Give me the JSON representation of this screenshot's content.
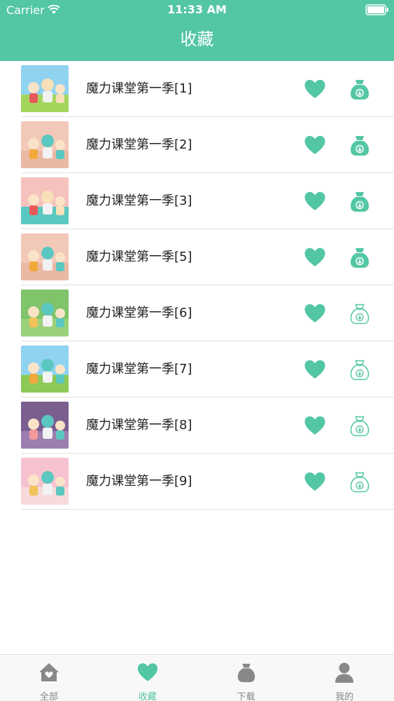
{
  "status_bar": {
    "carrier": "Carrier",
    "time": "11:33 AM",
    "wifi_icon": "wifi-icon",
    "battery_icon": "battery-icon"
  },
  "header": {
    "title": "收藏",
    "background": "#53c6a4"
  },
  "favorites": [
    {
      "title": "魔力课堂第一季[1]",
      "favorited": true,
      "downloaded": true
    },
    {
      "title": "魔力课堂第一季[2]",
      "favorited": true,
      "downloaded": true
    },
    {
      "title": "魔力课堂第一季[3]",
      "favorited": true,
      "downloaded": true
    },
    {
      "title": "魔力课堂第一季[5]",
      "favorited": true,
      "downloaded": true
    },
    {
      "title": "魔力课堂第一季[6]",
      "favorited": true,
      "downloaded": false
    },
    {
      "title": "魔力课堂第一季[7]",
      "favorited": true,
      "downloaded": false
    },
    {
      "title": "魔力课堂第一季[8]",
      "favorited": true,
      "downloaded": false
    },
    {
      "title": "魔力课堂第一季[9]",
      "favorited": true,
      "downloaded": false
    }
  ],
  "tabbar": {
    "tabs": [
      {
        "label": "全部",
        "icon": "home-icon",
        "active": false
      },
      {
        "label": "收藏",
        "icon": "heart-icon",
        "active": true
      },
      {
        "label": "下载",
        "icon": "download-bag-icon",
        "active": false
      },
      {
        "label": "我的",
        "icon": "person-icon",
        "active": false
      }
    ]
  },
  "colors": {
    "accent": "#53c6a4",
    "inactive": "#888888"
  }
}
